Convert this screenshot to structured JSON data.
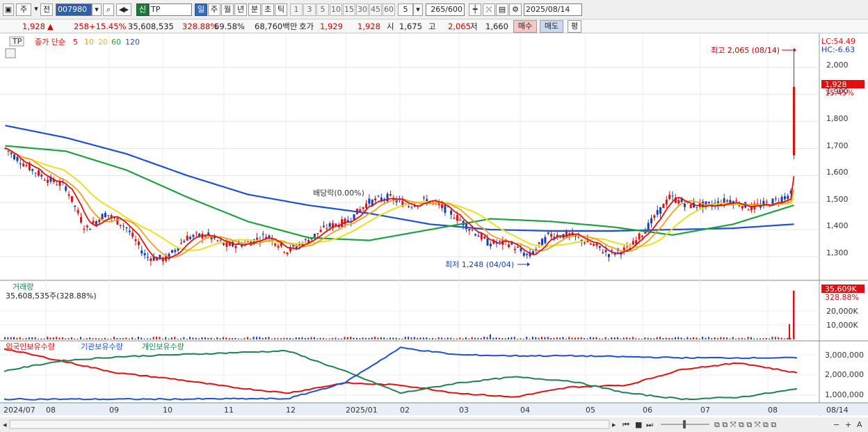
{
  "toolbar": {
    "period": "주",
    "prev": "전",
    "stock_code": "007980",
    "new_badge": "신",
    "stock_name": "TP",
    "periods": [
      "일",
      "주",
      "월",
      "년",
      "분",
      "초",
      "틱"
    ],
    "intervals": [
      "1",
      "3",
      "5",
      "10",
      "15",
      "30",
      "45",
      "60"
    ],
    "count_select": "5",
    "range": "265/600",
    "date": "2025/08/14"
  },
  "info": {
    "price": "1,928",
    "arrow": "▲",
    "change": "258",
    "change_pct": "+15.45%",
    "volume": "35,608,535",
    "volume_pct": "328.88%",
    "turnover_pct": "69.58%",
    "amount": "68,760백만",
    "quote_label": "호가",
    "bid": "1,929",
    "ask": "1,928",
    "open_label": "시",
    "open": "1,675",
    "high_label": "고",
    "high": "2,065",
    "low_label": "저",
    "low": "1,660",
    "buy_label": "매수",
    "sell_label": "매도",
    "eval_label": "평"
  },
  "legend": {
    "tp": "TP",
    "ma_label": "종가 단순",
    "ma_periods": [
      "5",
      "10",
      "20",
      "60",
      "120"
    ],
    "ma_colors": [
      "#e01010",
      "#f0a020",
      "#e8e020",
      "#20a040",
      "#2050d0"
    ]
  },
  "price_axis": {
    "ticks": [
      "2,000",
      "1,900",
      "1,800",
      "1,700",
      "1,600",
      "1,500",
      "1,400",
      "1,300"
    ],
    "lc": "LC:54.49",
    "hc": "HC:-6.63",
    "current": "1,928",
    "current_pct": "15.45%"
  },
  "annotations": {
    "high": "최고 2,065 (08/14)",
    "low": "최저 1,248 (04/04)",
    "dividend": "배당락(0.00%)"
  },
  "volume_panel": {
    "title": "거래량",
    "value": "35,608,535주(328.88%)",
    "axis": [
      "20,000K",
      "10,000K"
    ],
    "current": "35,609K",
    "current_pct": "328.88%"
  },
  "holdings_panel": {
    "legend": [
      "외국인보유수량",
      "기관보유수량",
      "개인보유수량"
    ],
    "legend_colors": [
      "#e01010",
      "#2050d0",
      "#208050"
    ],
    "axis": [
      "3,000,000",
      "2,000,000",
      "1,000,000"
    ]
  },
  "x_axis": {
    "labels": [
      "2024/07",
      "08",
      "09",
      "10",
      "11",
      "12",
      "2025/01",
      "02",
      "03",
      "04",
      "05",
      "06",
      "07",
      "08"
    ],
    "end": "08/14"
  },
  "chart_data": {
    "type": "line",
    "title": "",
    "ylabel": "",
    "ylim": [
      1220,
      2100
    ],
    "price_series": [
      [
        "2024-07",
        1700
      ],
      [
        "2024-07b",
        1640
      ],
      [
        "2024-07c",
        1590
      ],
      [
        "2024-08",
        1560
      ],
      [
        "2024-08b",
        1400
      ],
      [
        "2024-08c",
        1460
      ],
      [
        "2024-09",
        1410
      ],
      [
        "2024-09b",
        1300
      ],
      [
        "2024-09c",
        1290
      ],
      [
        "2024-10",
        1370
      ],
      [
        "2024-10b",
        1380
      ],
      [
        "2024-10c",
        1340
      ],
      [
        "2024-11",
        1350
      ],
      [
        "2024-11b",
        1380
      ],
      [
        "2024-11c",
        1320
      ],
      [
        "2024-12",
        1360
      ],
      [
        "2024-12b",
        1410
      ],
      [
        "2024-12c",
        1430
      ],
      [
        "2025-01",
        1500
      ],
      [
        "2025-01b",
        1520
      ],
      [
        "2025-02",
        1490
      ],
      [
        "2025-02b",
        1510
      ],
      [
        "2025-02c",
        1470
      ],
      [
        "2025-03",
        1410
      ],
      [
        "2025-03b",
        1350
      ],
      [
        "2025-03c",
        1350
      ],
      [
        "2025-04",
        1300
      ],
      [
        "2025-04b",
        1380
      ],
      [
        "2025-04c",
        1380
      ],
      [
        "2025-05",
        1350
      ],
      [
        "2025-05b",
        1310
      ],
      [
        "2025-05c",
        1330
      ],
      [
        "2025-06",
        1420
      ],
      [
        "2025-06b",
        1520
      ],
      [
        "2025-06c",
        1490
      ],
      [
        "2025-07",
        1490
      ],
      [
        "2025-07b",
        1510
      ],
      [
        "2025-07c",
        1480
      ],
      [
        "2025-08",
        1500
      ],
      [
        "2025-08b",
        1530
      ],
      [
        "2025-08-14",
        1928
      ]
    ],
    "ma120": [
      1785,
      1740,
      1680,
      1600,
      1530,
      1490,
      1460,
      1420,
      1400,
      1395,
      1395,
      1400,
      1405,
      1420
    ],
    "ma60": [
      1710,
      1690,
      1620,
      1520,
      1430,
      1370,
      1360,
      1400,
      1440,
      1430,
      1410,
      1380,
      1420,
      1490
    ],
    "high": 2065,
    "low": 1248
  }
}
